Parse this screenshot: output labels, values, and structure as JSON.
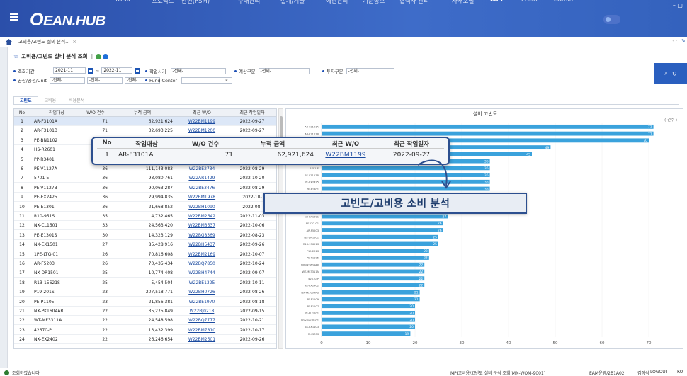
{
  "app": {
    "logo_prefix": "O",
    "logo_text": "EAN.HUB"
  },
  "nav": [
    {
      "label": "TANK",
      "active": false
    },
    {
      "label": "프로젝트",
      "active": false
    },
    {
      "label": "안전(PSM)",
      "active": false
    },
    {
      "label": "구매관리",
      "active": false
    },
    {
      "label": "설계/기술",
      "active": false
    },
    {
      "label": "예산관리",
      "active": false
    },
    {
      "label": "기준정보",
      "active": false
    },
    {
      "label": "협력사 관리",
      "active": false
    },
    {
      "label": "자재포털",
      "active": false
    },
    {
      "label": "MPI",
      "active": true
    },
    {
      "label": "LDAR",
      "active": false
    },
    {
      "label": "Admin",
      "active": false
    }
  ],
  "doc_tab": {
    "label": "고비용/고빈도 설비 분석...",
    "close": "×"
  },
  "strip_arrows": "‹ ›",
  "page_title": "고비용/고빈도 설비 분석 조회",
  "page_sep": "|",
  "filters": {
    "period_label": "조회기간",
    "date_from": "2021-11",
    "date_to": "2022-11",
    "tilde": "~",
    "worktype_label": "작업시기",
    "worktype_value": "-전체-",
    "budget_label": "예산구분",
    "budget_value": "-전체-",
    "invest_label": "투자구분",
    "invest_value": "-전체-",
    "plant_label": "공장/공정/Unit",
    "plant_v1": "-전체-",
    "plant_v2": "-전체-",
    "plant_v3": "-전체-",
    "fund_label": "Fund Center",
    "fund_value": ""
  },
  "subtabs": [
    "고빈도",
    "고비용",
    "비용분석"
  ],
  "grid": {
    "headers": [
      "No",
      "작업대상",
      "W/O 건수",
      "누적 금액",
      "최근 W/O",
      "최근 작업일자"
    ],
    "rows": [
      [
        "1",
        "AR-F3101A",
        "71",
        "62,921,624",
        "W22BM1199",
        "2022-09-27"
      ],
      [
        "2",
        "AR-F3101B",
        "71",
        "32,693,225",
        "W22BM1200",
        "2022-09-27"
      ],
      [
        "3",
        "PE-BN1102",
        "70",
        "",
        "",
        ""
      ],
      [
        "4",
        "HS-R2601",
        "",
        "",
        "",
        ""
      ],
      [
        "5",
        "PP-R3401",
        "",
        "",
        "",
        ""
      ],
      [
        "6",
        "PE-V1127A",
        "36",
        "111,143,083",
        "W22BE2734",
        "2022-08-29"
      ],
      [
        "7",
        "5701-E",
        "36",
        "93,080,761",
        "W22AR1429",
        "2022-10-20"
      ],
      [
        "8",
        "PE-V1127B",
        "36",
        "90,063,287",
        "W22BE3476",
        "2022-08-29"
      ],
      [
        "9",
        "PE-EX2425",
        "36",
        "29,994,835",
        "W22BM1978",
        "2022-10-"
      ],
      [
        "10",
        "PE-E1301",
        "36",
        "21,668,852",
        "W22BH1090",
        "2022-08-"
      ],
      [
        "11",
        "R10-951S",
        "35",
        "4,732,465",
        "W22BM2642",
        "2022-11-03"
      ],
      [
        "12",
        "NX-CL1501",
        "33",
        "24,563,420",
        "W22BM3537",
        "2022-10-06"
      ],
      [
        "13",
        "PE-E1301S",
        "30",
        "14,323,129",
        "W22BG8369",
        "2022-08-23"
      ],
      [
        "14",
        "NX-EX1501",
        "27",
        "85,428,916",
        "W22BH5437",
        "2022-09-26"
      ],
      [
        "15",
        "1PE-LTG-01",
        "26",
        "70,816,608",
        "W22BM2169",
        "2022-10-07"
      ],
      [
        "16",
        "AR-F5203",
        "26",
        "70,435,434",
        "W22BQ7850",
        "2022-10-24"
      ],
      [
        "17",
        "NX-DR1501",
        "25",
        "10,774,408",
        "W22BH4744",
        "2022-09-07"
      ],
      [
        "18",
        "R13-15621S",
        "25",
        "5,454,504",
        "W22BE1325",
        "2022-10-11"
      ],
      [
        "19",
        "P19-201S",
        "23",
        "207,518,771",
        "W22BH0726",
        "2022-08-26"
      ],
      [
        "20",
        "PE-P1105",
        "23",
        "21,856,381",
        "W22BE1970",
        "2022-08-18"
      ],
      [
        "21",
        "NX-PK1604AR",
        "22",
        "35,275,849",
        "W22BJ0218",
        "2022-09-15"
      ],
      [
        "22",
        "WT-MF3311A",
        "22",
        "24,548,598",
        "W22BQ7777",
        "2022-10-21"
      ],
      [
        "23",
        "42670-P",
        "22",
        "13,432,399",
        "W22BM7810",
        "2022-10-17"
      ],
      [
        "24",
        "NX-EX2402",
        "22",
        "26,246,654",
        "W22BM2501",
        "2022-09-26"
      ]
    ]
  },
  "chart_title": "설비 고빈도",
  "chart_unit": "( 건수 )",
  "chart_data": {
    "type": "bar",
    "orientation": "horizontal",
    "title": "설비 고빈도",
    "categories": [
      "AR-F3101A",
      "AR-F3101B",
      "PE-BN1102",
      "HS-R2601",
      "PP-R3401",
      "PE-V1127A",
      "5701-E",
      "PE-V1127B",
      "PE-EX2425",
      "PE-E1301",
      "R10-951S",
      "NX-CL1501",
      "PE-E1301S",
      "NX-EX1501",
      "1PE-LTG-01",
      "AR-F5203",
      "NX-DR1501",
      "R13-15621S",
      "P19-201S",
      "PE-P1105",
      "NX-PK1604AR",
      "WT-MF3311A",
      "42670-P",
      "NX-EX2402",
      "NX-PK1604AS",
      "PE-P1109",
      "PE-P1107",
      "PE-PU1101",
      "Polymer-IV-01",
      "NX-EX1103",
      "R-4370S"
    ],
    "values": [
      71,
      71,
      70,
      49,
      45,
      36,
      36,
      36,
      36,
      36,
      35,
      33,
      30,
      27,
      26,
      26,
      25,
      25,
      23,
      23,
      22,
      22,
      22,
      22,
      21,
      21,
      20,
      20,
      20,
      20,
      19
    ],
    "xlim": [
      0,
      70
    ],
    "xticks": [
      0,
      10,
      20,
      30,
      40,
      50,
      60,
      70
    ],
    "legend": "none"
  },
  "overlay": {
    "headers": [
      "No",
      "작업대상",
      "W/O 건수",
      "누적 금액",
      "최근 W/O",
      "최근 작업일자"
    ],
    "row": [
      "1",
      "AR-F3101A",
      "71",
      "62,921,624",
      "W22BM1199",
      "2022-09-27"
    ]
  },
  "callout": "고빈도/고비용 소비 분석",
  "status": {
    "left": "조회하였습니다.",
    "menu_path": "MPI고비용/고빈도 설비 분석 조회[MN-WOM-9001]",
    "company": "EAM운영/2B1A02",
    "user": "김장석",
    "logout": "LOGOUT",
    "lang": "KO"
  },
  "colors": {
    "bar": "#3aa2dc",
    "brand": "#2b4faa",
    "accent": "#1a4db3"
  }
}
